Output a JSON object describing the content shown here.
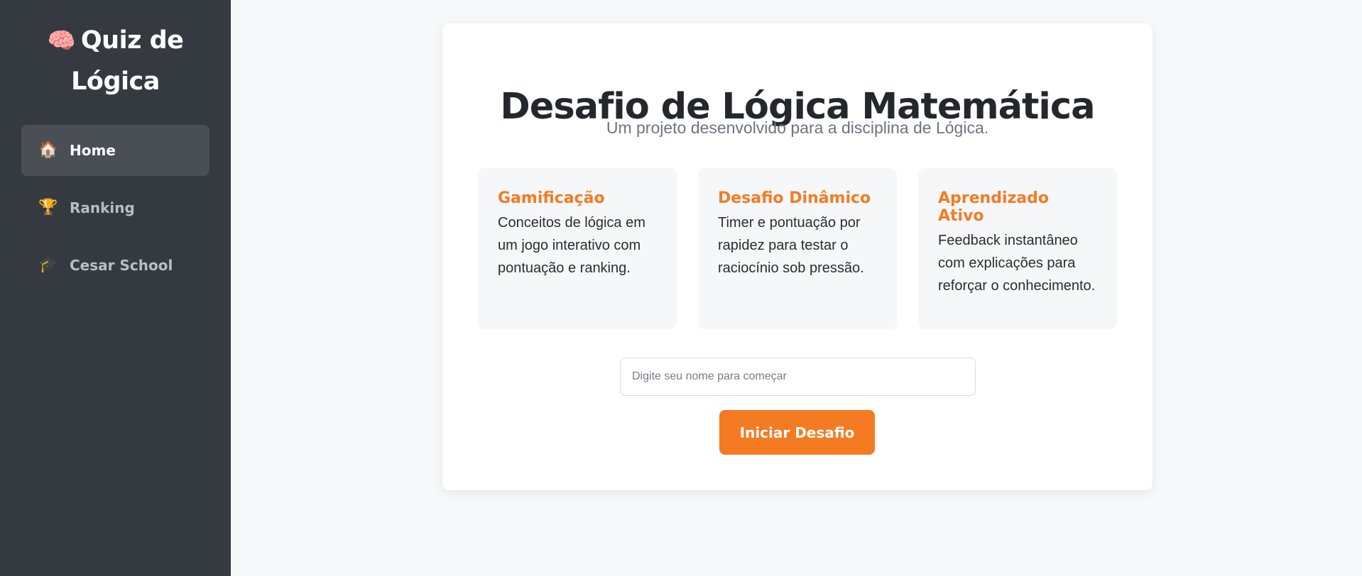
{
  "sidebar": {
    "brand": {
      "icon": "🧠",
      "title": "Quiz de Lógica"
    },
    "items": [
      {
        "icon": "🏠",
        "label": "Home",
        "active": true
      },
      {
        "icon": "🏆",
        "label": "Ranking",
        "active": false
      },
      {
        "icon": "🎓",
        "label": "Cesar School",
        "active": false
      }
    ]
  },
  "main": {
    "title": "Desafio de Lógica Matemática",
    "subtitle": "Um projeto desenvolvido para a disciplina de Lógica.",
    "features": [
      {
        "title": "Gamificação",
        "text": "Conceitos de lógica em um jogo interativo com pontuação e ranking."
      },
      {
        "title": "Desafio Dinâmico",
        "text": "Timer e pontuação por rapidez para testar o raciocínio sob pressão."
      },
      {
        "title": "Aprendizado Ativo",
        "text": "Feedback instantâneo com explicações para reforçar o conhecimento."
      }
    ],
    "name_input": {
      "placeholder": "Digite seu nome para começar",
      "value": ""
    },
    "start_button": "Iniciar Desafio"
  },
  "colors": {
    "sidebar_bg": "#353a41",
    "accent": "#f47b22",
    "page_bg": "#f7f8fa"
  }
}
